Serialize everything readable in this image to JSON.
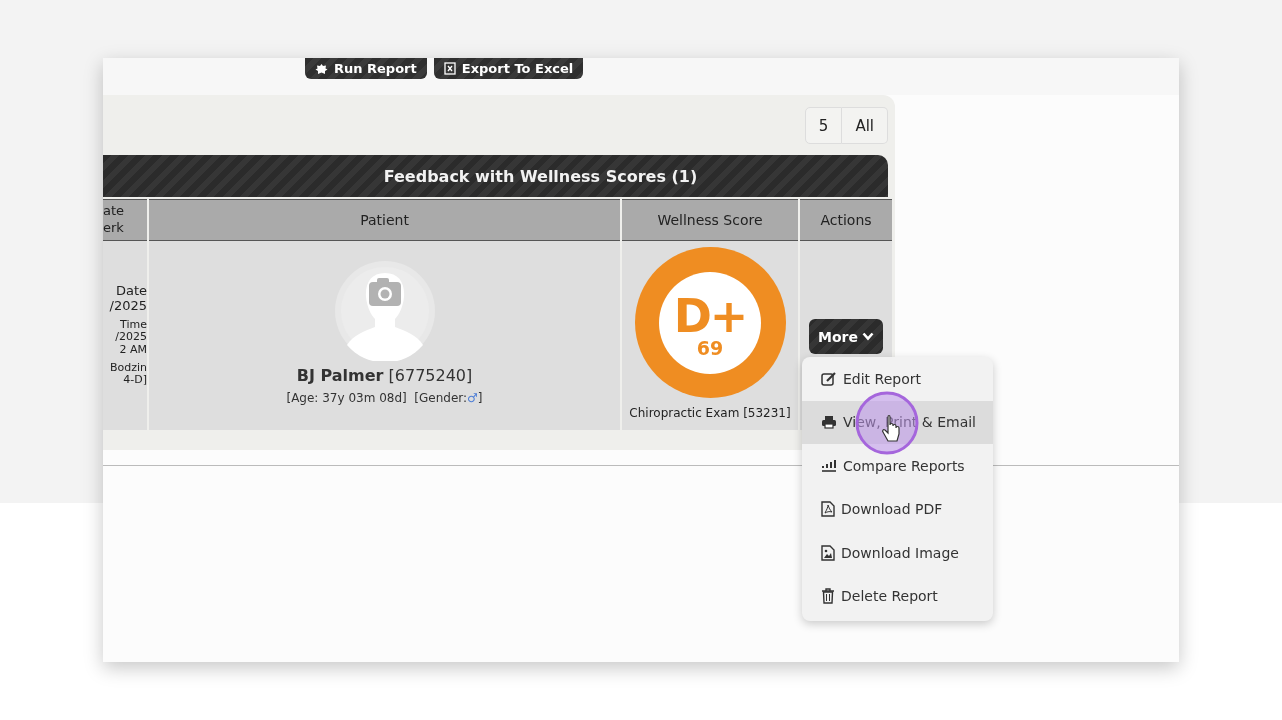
{
  "toolbar": {
    "buttons": [
      {
        "label": "Run Report",
        "kind": "run"
      },
      {
        "label": "Export To Excel",
        "kind": "excel"
      }
    ]
  },
  "pager": [
    {
      "label": "5"
    },
    {
      "label": "All"
    }
  ],
  "panel": {
    "title": "Feedback with Wellness Scores (1)"
  },
  "table": {
    "columns": [
      {
        "lines": [
          "ate",
          "erk"
        ]
      },
      {
        "lines": [
          "Patient"
        ]
      },
      {
        "lines": [
          "Wellness Score"
        ]
      },
      {
        "lines": [
          "Actions"
        ]
      }
    ],
    "rows": [
      {
        "column_1": [
          [
            "Date",
            "/2025"
          ],
          [
            "Time",
            "/2025",
            "2 AM"
          ],
          [
            "Bodzin",
            "4-D]"
          ]
        ],
        "patient": {
          "name": "BJ Palmer",
          "id": "[6775240]",
          "age": "[Age: 37y 03m 08d]",
          "gender_label": "[Gender:",
          "gender_symbol": "♂",
          "gender_close": "]"
        },
        "score": {
          "grade": "D+",
          "value": "69",
          "exam": "Chiropractic Exam [53231]"
        },
        "action": {
          "label": "More"
        }
      }
    ]
  },
  "menu": {
    "items": [
      {
        "label": "Edit Report",
        "kind": "edit",
        "selected": false
      },
      {
        "label": "View, Print & Email",
        "kind": "print",
        "selected": true
      },
      {
        "label": "Compare Reports",
        "kind": "compare",
        "selected": false
      },
      {
        "label": "Download PDF",
        "kind": "pdf",
        "selected": false
      },
      {
        "label": "Download Image",
        "kind": "image",
        "selected": false
      },
      {
        "label": "Delete Report",
        "kind": "delete",
        "selected": false
      }
    ]
  }
}
